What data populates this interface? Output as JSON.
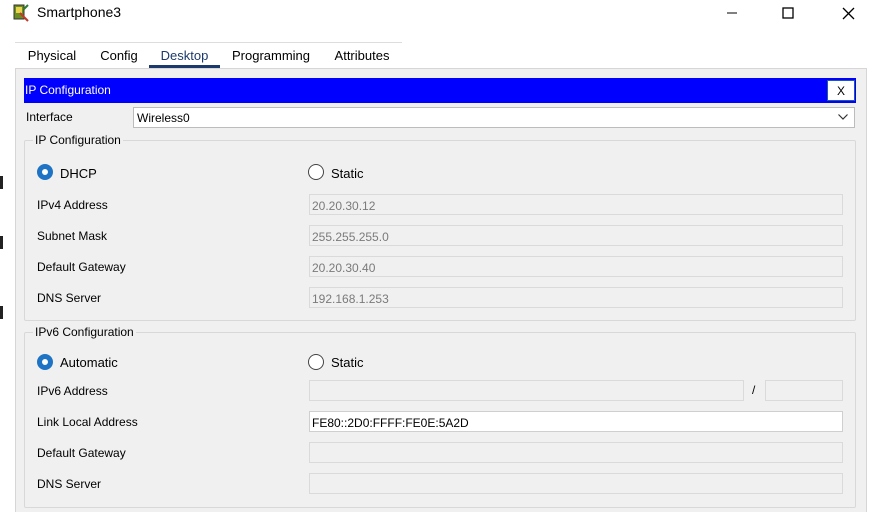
{
  "window": {
    "title": "Smartphone3"
  },
  "tabs": [
    {
      "label": "Physical"
    },
    {
      "label": "Config"
    },
    {
      "label": "Desktop"
    },
    {
      "label": "Programming"
    },
    {
      "label": "Attributes"
    }
  ],
  "active_tab": "Desktop",
  "ip_config": {
    "header": "IP Configuration",
    "close_label": "X",
    "interface_label": "Interface",
    "interface_value": "Wireless0",
    "ipv4": {
      "legend": "IP Configuration",
      "dhcp_label": "DHCP",
      "static_label": "Static",
      "selected_mode": "DHCP",
      "fields": [
        {
          "label": "IPv4 Address",
          "value": "20.20.30.12"
        },
        {
          "label": "Subnet Mask",
          "value": "255.255.255.0"
        },
        {
          "label": "Default Gateway",
          "value": "20.20.30.40"
        },
        {
          "label": "DNS Server",
          "value": "192.168.1.253"
        }
      ]
    },
    "ipv6": {
      "legend": "IPv6 Configuration",
      "auto_label": "Automatic",
      "static_label": "Static",
      "selected_mode": "Automatic",
      "prefix_separator": "/",
      "fields": [
        {
          "label": "IPv6 Address",
          "value": "",
          "prefix": ""
        },
        {
          "label": "Link Local Address",
          "value": "FE80::2D0:FFFF:FE0E:5A2D"
        },
        {
          "label": "Default Gateway",
          "value": ""
        },
        {
          "label": "DNS Server",
          "value": ""
        }
      ]
    }
  },
  "colors": {
    "header_bar": "#0000ff",
    "radio_selected": "#1f73c4",
    "active_tab": "#1b3a6b"
  }
}
